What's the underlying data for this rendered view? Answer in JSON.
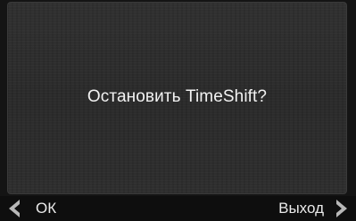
{
  "dialog": {
    "message": "Остановить TimeShift?"
  },
  "softkeys": {
    "left": {
      "label": "ОК",
      "icon": "chevron-left-icon"
    },
    "right": {
      "label": "Выход",
      "icon": "chevron-right-icon"
    }
  },
  "colors": {
    "background": "#141414",
    "dialog": "#2d2d2d",
    "text": "#f2f2f2",
    "arrow": "#b8b8b8"
  }
}
